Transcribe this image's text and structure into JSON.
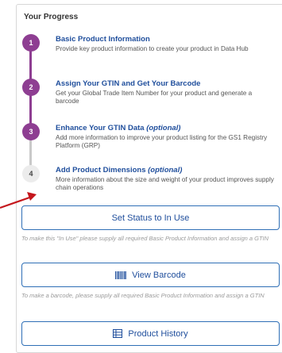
{
  "progress": {
    "title": "Your Progress",
    "steps": [
      {
        "number": "1",
        "title": "Basic Product Information",
        "optional": "",
        "description": "Provide key product information to create your product in Data Hub",
        "state": "done"
      },
      {
        "number": "2",
        "title": "Assign Your GTIN and Get Your Barcode",
        "optional": "",
        "description": "Get your Global Trade Item Number for your product and generate a barcode",
        "state": "done"
      },
      {
        "number": "3",
        "title": "Enhance Your GTIN Data",
        "optional": "(optional)",
        "description": "Add more information to improve your product listing for the GS1 Registry Platform (GRP)",
        "state": "done"
      },
      {
        "number": "4",
        "title": "Add Product Dimensions",
        "optional": "(optional)",
        "description": "More information about the size and weight of your product improves supply chain operations",
        "state": "todo"
      }
    ]
  },
  "actions": {
    "set_status_label": "Set Status to In Use",
    "set_status_note": "To make this \"In Use\" please supply all required Basic Product Information and assign a GTIN",
    "view_barcode_label": "View Barcode",
    "view_barcode_icon": "barcode-icon",
    "view_barcode_note": "To make a barcode, please supply all required Basic Product Information and assign a GTIN",
    "product_history_label": "Product History",
    "product_history_icon": "table-icon"
  },
  "colors": {
    "accent_purple": "#8e3e92",
    "link_blue": "#1f4e9c",
    "button_border": "#2f6fb6",
    "annotation_arrow": "#c4161c"
  }
}
